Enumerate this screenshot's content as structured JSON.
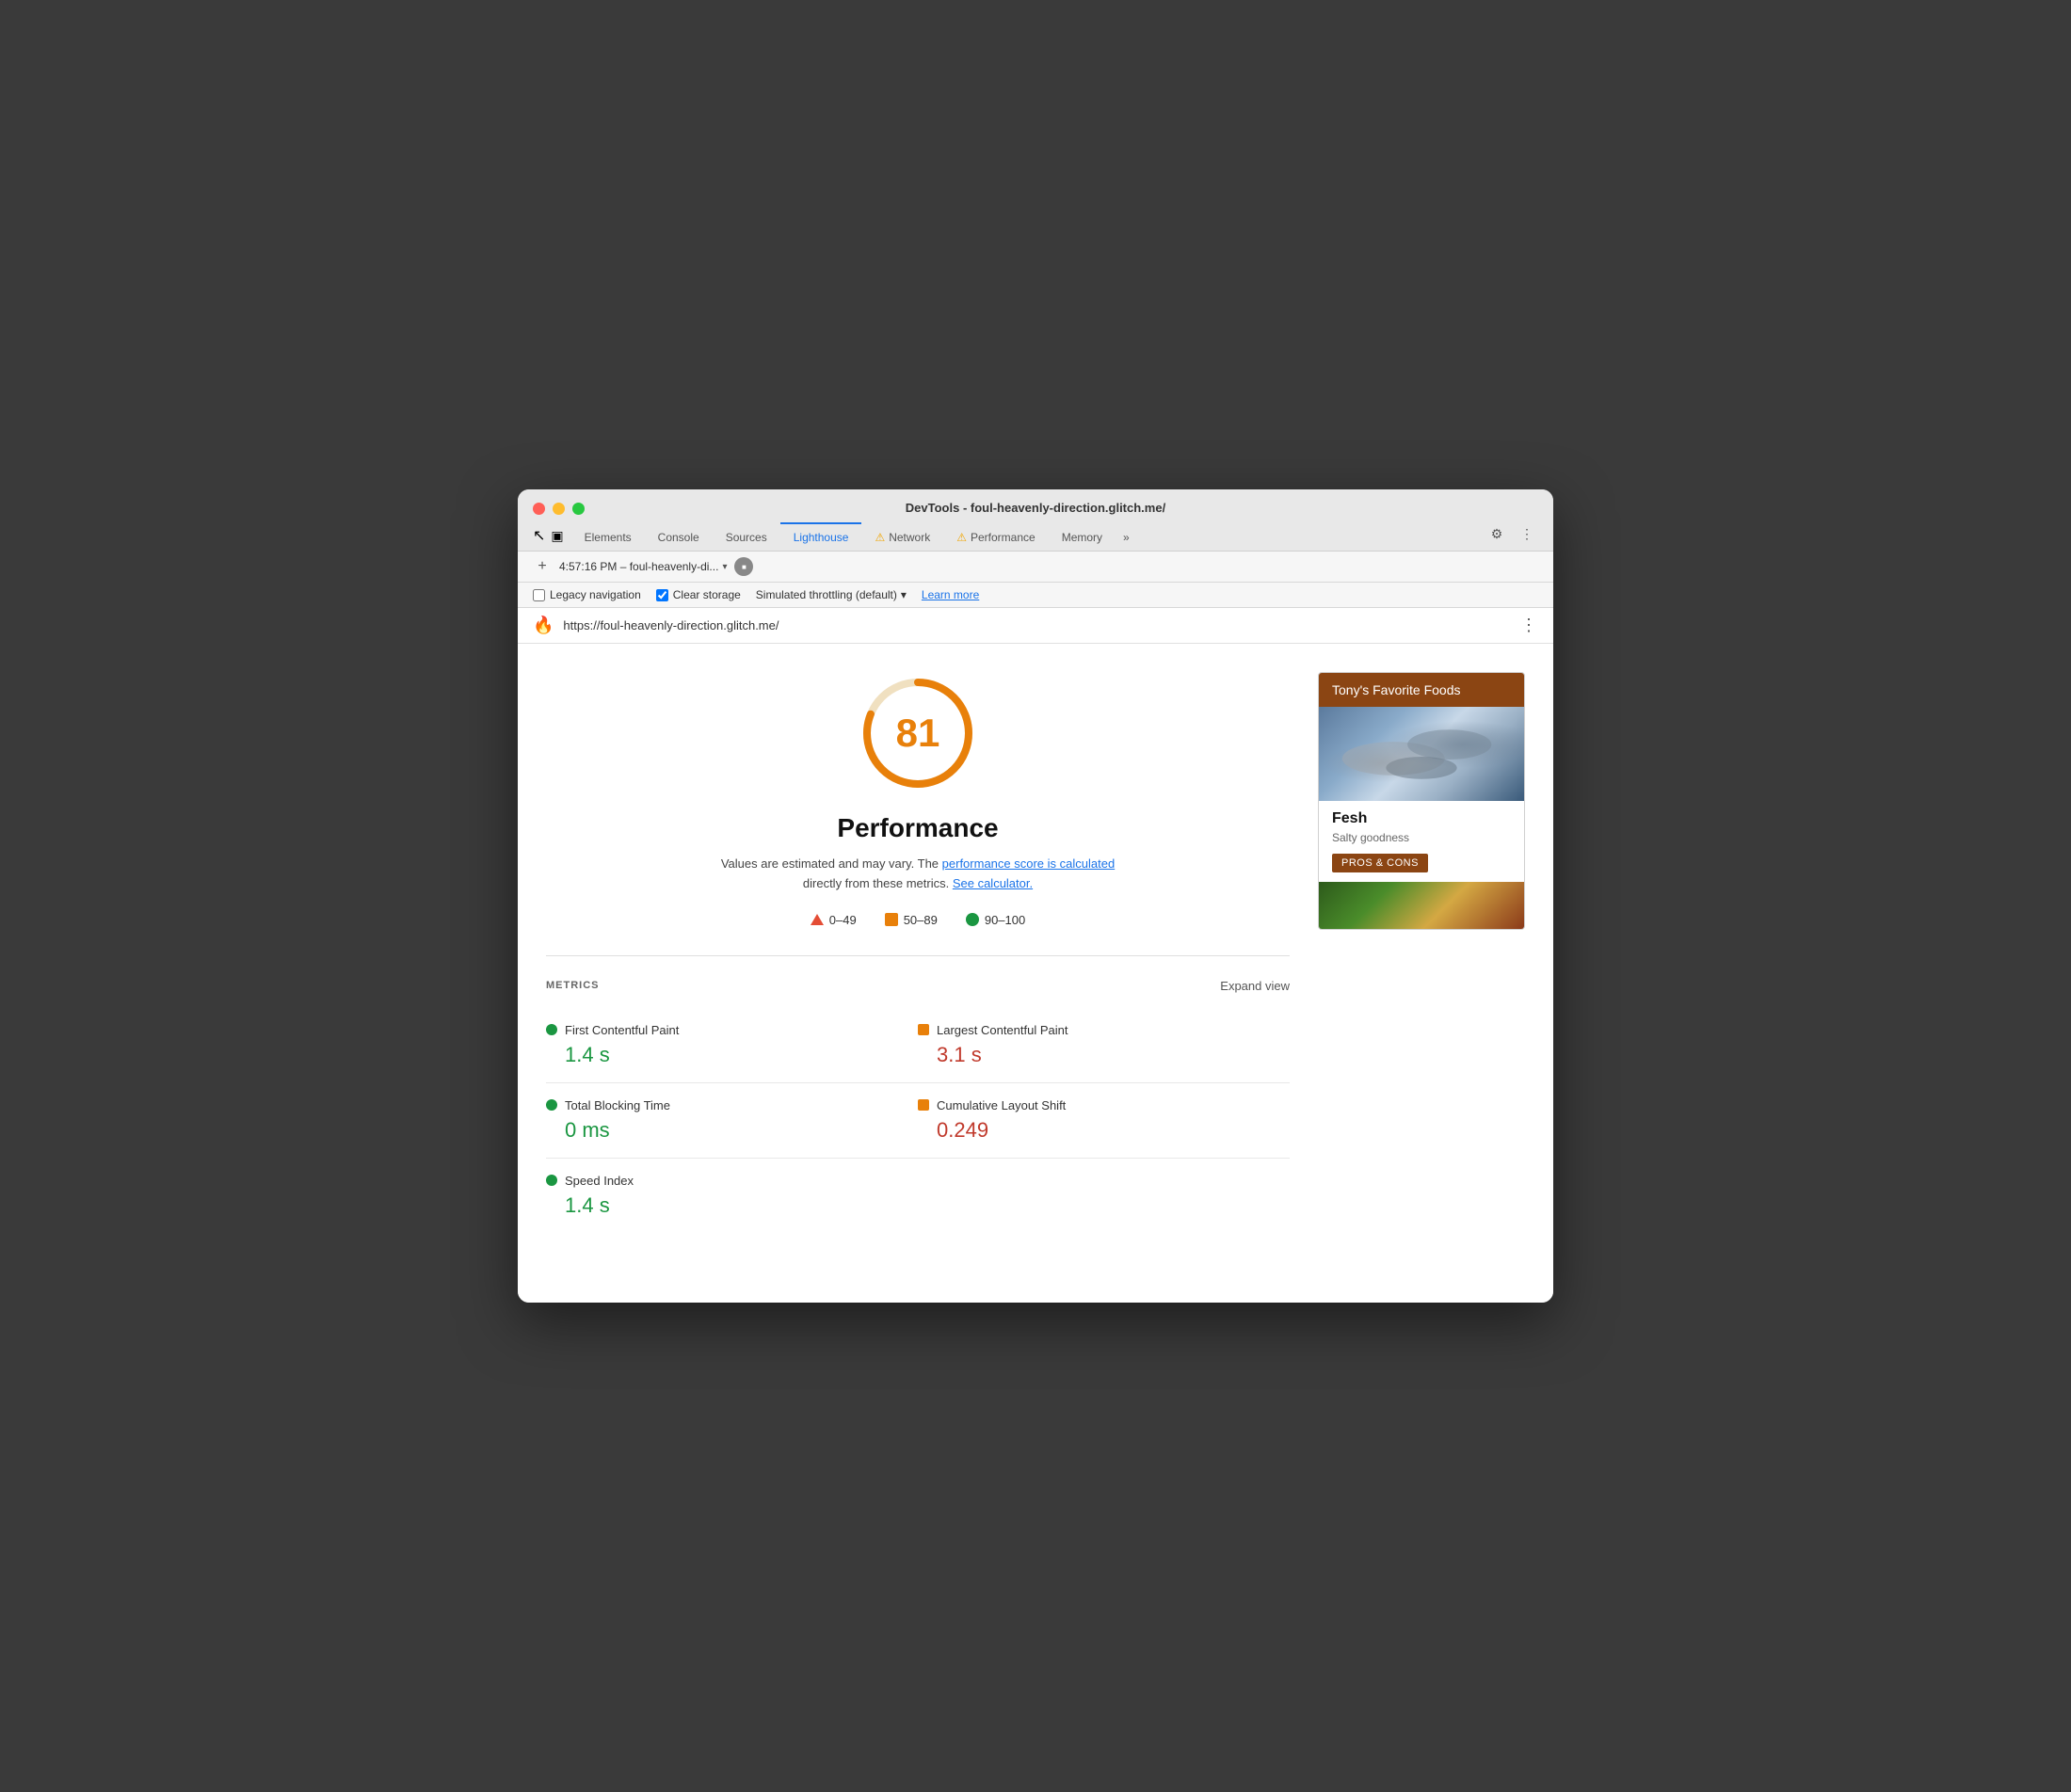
{
  "window": {
    "title": "DevTools - foul-heavenly-direction.glitch.me/"
  },
  "tabs": [
    {
      "id": "elements",
      "label": "Elements",
      "active": false,
      "warning": false
    },
    {
      "id": "console",
      "label": "Console",
      "active": false,
      "warning": false
    },
    {
      "id": "sources",
      "label": "Sources",
      "active": false,
      "warning": false
    },
    {
      "id": "lighthouse",
      "label": "Lighthouse",
      "active": true,
      "warning": false
    },
    {
      "id": "network",
      "label": "Network",
      "active": false,
      "warning": true
    },
    {
      "id": "performance",
      "label": "Performance",
      "active": false,
      "warning": true
    },
    {
      "id": "memory",
      "label": "Memory",
      "active": false,
      "warning": false
    }
  ],
  "toolbar": {
    "time_label": "4:57:16 PM – foul-heavenly-di...",
    "more_label": "»"
  },
  "options": {
    "legacy_nav_label": "Legacy navigation",
    "legacy_nav_checked": false,
    "clear_storage_label": "Clear storage",
    "clear_storage_checked": true,
    "throttling_label": "Simulated throttling (default)",
    "learn_more_label": "Learn more"
  },
  "url_bar": {
    "url": "https://foul-heavenly-direction.glitch.me/",
    "icon": "🔥"
  },
  "score": {
    "value": "81",
    "title": "Performance",
    "desc_text": "Values are estimated and may vary. The ",
    "link1_text": "performance score is calculated",
    "link1_mid": " directly from these metrics. ",
    "link2_text": "See calculator.",
    "legend": [
      {
        "type": "triangle",
        "range": "0–49"
      },
      {
        "type": "square",
        "range": "50–89"
      },
      {
        "type": "circle",
        "range": "90–100"
      }
    ]
  },
  "metrics": {
    "label": "METRICS",
    "expand_label": "Expand view",
    "items": [
      {
        "id": "fcp",
        "name": "First Contentful Paint",
        "value": "1.4 s",
        "color": "green",
        "col": 0
      },
      {
        "id": "lcp",
        "name": "Largest Contentful Paint",
        "value": "3.1 s",
        "color": "red",
        "col": 1
      },
      {
        "id": "tbt",
        "name": "Total Blocking Time",
        "value": "0 ms",
        "color": "green",
        "col": 0
      },
      {
        "id": "cls",
        "name": "Cumulative Layout Shift",
        "value": "0.249",
        "color": "red",
        "col": 1
      },
      {
        "id": "si",
        "name": "Speed Index",
        "value": "1.4 s",
        "color": "green",
        "col": 0
      }
    ]
  },
  "preview": {
    "title": "Tony's Favorite Foods",
    "food_name": "Fesh",
    "food_desc": "Salty goodness",
    "btn_label": "PROS & CONS"
  }
}
